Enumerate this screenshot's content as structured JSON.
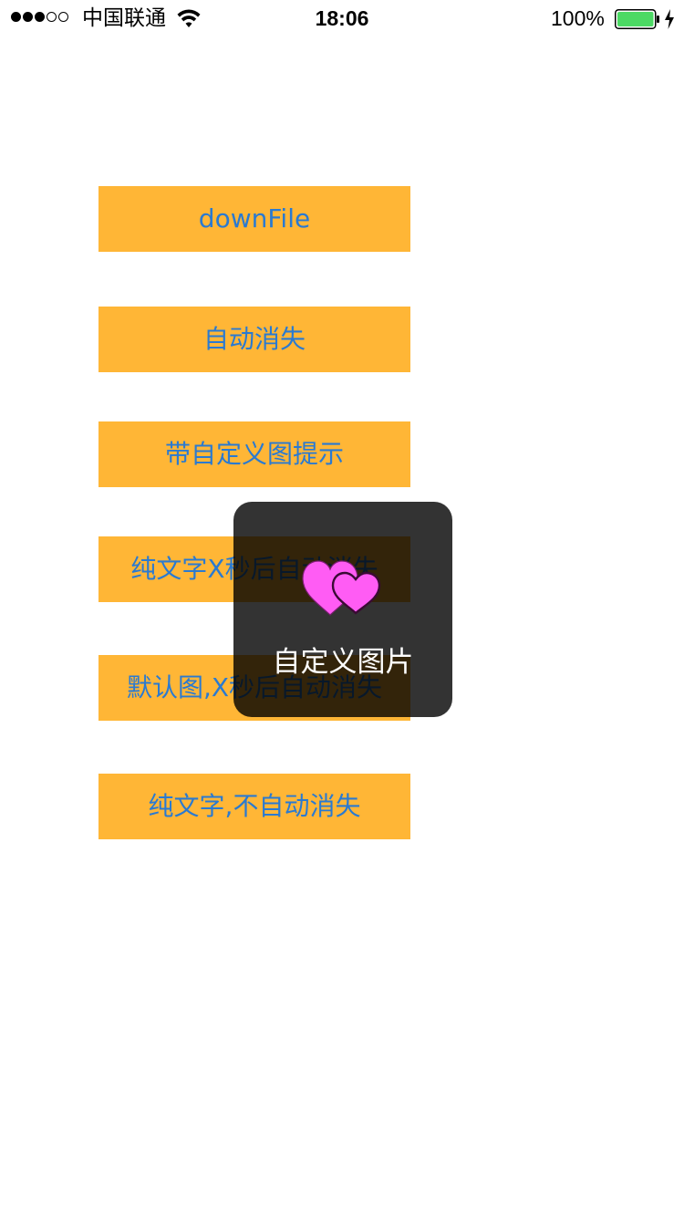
{
  "status_bar": {
    "carrier": "中国联通",
    "time": "18:06",
    "battery_percent": "100%",
    "signal_bars_filled": 3,
    "signal_bars_total": 5,
    "battery_level": 1.0,
    "charging": true,
    "battery_color": "#4cd964"
  },
  "buttons": [
    {
      "label": "downFile"
    },
    {
      "label": "自动消失"
    },
    {
      "label": "带自定义图提示"
    },
    {
      "label": "纯文字X秒后自动消失"
    },
    {
      "label": "默认图,X秒后自动消失"
    },
    {
      "label": "纯文字,不自动消失"
    }
  ],
  "hud": {
    "image": "hearts-icon",
    "image_color": "#ff5cf4",
    "label": "自定义图片"
  },
  "colors": {
    "button_background": "#ffb636",
    "button_text": "#2a7ad1",
    "hud_background": "rgba(0,0,0,0.8)"
  }
}
